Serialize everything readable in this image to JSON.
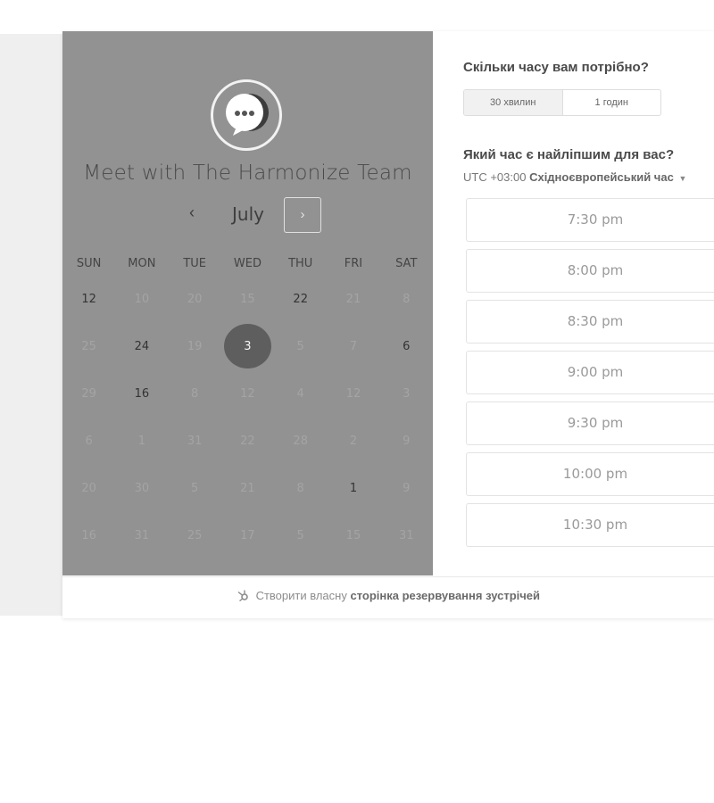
{
  "calendar": {
    "title": "Meet with The Harmonize Team",
    "month": "July",
    "prev_label": "‹",
    "next_label": "›",
    "weekdays": [
      "SUN",
      "MON",
      "TUE",
      "WED",
      "THU",
      "FRI",
      "SAT"
    ],
    "weeks": [
      [
        {
          "d": "12",
          "s": "active"
        },
        {
          "d": "10",
          "s": "muted"
        },
        {
          "d": "20",
          "s": "muted"
        },
        {
          "d": "15",
          "s": "muted"
        },
        {
          "d": "22",
          "s": "active"
        },
        {
          "d": "21",
          "s": "muted"
        },
        {
          "d": "8",
          "s": "muted"
        }
      ],
      [
        {
          "d": "25",
          "s": "muted"
        },
        {
          "d": "24",
          "s": "active"
        },
        {
          "d": "19",
          "s": "muted"
        },
        {
          "d": "3",
          "s": "selected"
        },
        {
          "d": "5",
          "s": "muted"
        },
        {
          "d": "7",
          "s": "muted"
        },
        {
          "d": "6",
          "s": "active"
        }
      ],
      [
        {
          "d": "29",
          "s": "muted"
        },
        {
          "d": "16",
          "s": "active"
        },
        {
          "d": "8",
          "s": "muted"
        },
        {
          "d": "12",
          "s": "muted"
        },
        {
          "d": "4",
          "s": "muted"
        },
        {
          "d": "12",
          "s": "muted"
        },
        {
          "d": "3",
          "s": "muted"
        }
      ],
      [
        {
          "d": "6",
          "s": "muted"
        },
        {
          "d": "1",
          "s": "muted"
        },
        {
          "d": "31",
          "s": "muted"
        },
        {
          "d": "22",
          "s": "muted"
        },
        {
          "d": "28",
          "s": "muted"
        },
        {
          "d": "2",
          "s": "muted"
        },
        {
          "d": "9",
          "s": "muted"
        }
      ],
      [
        {
          "d": "20",
          "s": "muted"
        },
        {
          "d": "30",
          "s": "muted"
        },
        {
          "d": "5",
          "s": "muted"
        },
        {
          "d": "21",
          "s": "muted"
        },
        {
          "d": "8",
          "s": "muted"
        },
        {
          "d": "1",
          "s": "active"
        },
        {
          "d": "9",
          "s": "muted"
        }
      ],
      [
        {
          "d": "16",
          "s": "muted"
        },
        {
          "d": "31",
          "s": "muted"
        },
        {
          "d": "25",
          "s": "muted"
        },
        {
          "d": "17",
          "s": "muted"
        },
        {
          "d": "5",
          "s": "muted"
        },
        {
          "d": "15",
          "s": "muted"
        },
        {
          "d": "31",
          "s": "muted"
        }
      ]
    ]
  },
  "duration": {
    "question": "Скільки часу вам потрібно?",
    "options": [
      "30 хвилин",
      "1 годин"
    ],
    "selected": "30 хвилин"
  },
  "time": {
    "question": "Який час є найліпшим для вас?",
    "tz_offset": "UTC +03:00",
    "tz_name": "Східноєвропейський час",
    "slots": [
      "7:30 pm",
      "8:00 pm",
      "8:30 pm",
      "9:00 pm",
      "9:30 pm",
      "10:00 pm",
      "10:30 pm"
    ]
  },
  "footer": {
    "prefix": "Створити власну",
    "link": "сторінка резервування зустрічей"
  },
  "icons": {
    "avatar": "chat-bubble-icon",
    "footer": "hubspot-sprocket-icon",
    "tz_dropdown": "caret-down-icon"
  }
}
